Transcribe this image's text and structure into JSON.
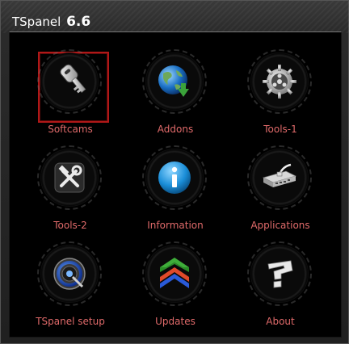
{
  "window": {
    "title": "TSpanel",
    "version": "6.6"
  },
  "menu": {
    "items": [
      {
        "label": "Softcams",
        "icon": "key-icon",
        "selected": true
      },
      {
        "label": "Addons",
        "icon": "globe-download-icon",
        "selected": false
      },
      {
        "label": "Tools-1",
        "icon": "gear-icon",
        "selected": false
      },
      {
        "label": "Tools-2",
        "icon": "wrench-hammer-icon",
        "selected": false
      },
      {
        "label": "Information",
        "icon": "info-icon",
        "selected": false
      },
      {
        "label": "Applications",
        "icon": "network-device-icon",
        "selected": false
      },
      {
        "label": "TSpanel setup",
        "icon": "power-knob-icon",
        "selected": false
      },
      {
        "label": "Updates",
        "icon": "updates-arrows-icon",
        "selected": false
      },
      {
        "label": "About",
        "icon": "question-icon",
        "selected": false
      }
    ]
  },
  "colors": {
    "label": "#e06a6a",
    "selection": "#b01818",
    "background": "#000000"
  }
}
